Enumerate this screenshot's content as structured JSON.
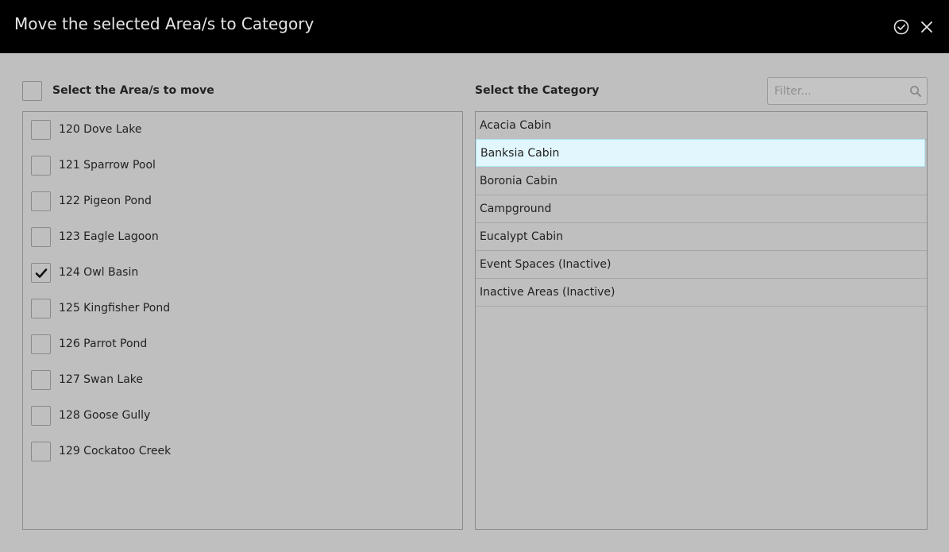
{
  "dialog": {
    "title": "Move the selected Area/s to Category",
    "confirm_icon": "check-circle-icon",
    "close_icon": "close-icon"
  },
  "areas": {
    "heading": "Select the Area/s to move",
    "select_all_checked": false,
    "items": [
      {
        "label": "120 Dove Lake",
        "checked": false
      },
      {
        "label": "121 Sparrow Pool",
        "checked": false
      },
      {
        "label": "122 Pigeon Pond",
        "checked": false
      },
      {
        "label": "123 Eagle Lagoon",
        "checked": false
      },
      {
        "label": "124 Owl Basin",
        "checked": true
      },
      {
        "label": "125 Kingfisher Pond",
        "checked": false
      },
      {
        "label": "126 Parrot Pond",
        "checked": false
      },
      {
        "label": "127 Swan Lake",
        "checked": false
      },
      {
        "label": "128 Goose Gully",
        "checked": false
      },
      {
        "label": "129 Cockatoo Creek",
        "checked": false
      }
    ]
  },
  "categories": {
    "heading": "Select the Category",
    "filter": {
      "placeholder": "Filter...",
      "value": ""
    },
    "selected": "Banksia Cabin",
    "items": [
      {
        "label": "Acacia Cabin"
      },
      {
        "label": "Banksia Cabin"
      },
      {
        "label": "Boronia Cabin"
      },
      {
        "label": "Campground"
      },
      {
        "label": "Eucalypt Cabin"
      },
      {
        "label": "Event Spaces (Inactive)"
      },
      {
        "label": "Inactive Areas (Inactive)"
      }
    ]
  },
  "colors": {
    "titlebar_bg": "#000000",
    "body_bg": "#bfbfbf",
    "selected_row_bg": "#e1f6fd"
  }
}
